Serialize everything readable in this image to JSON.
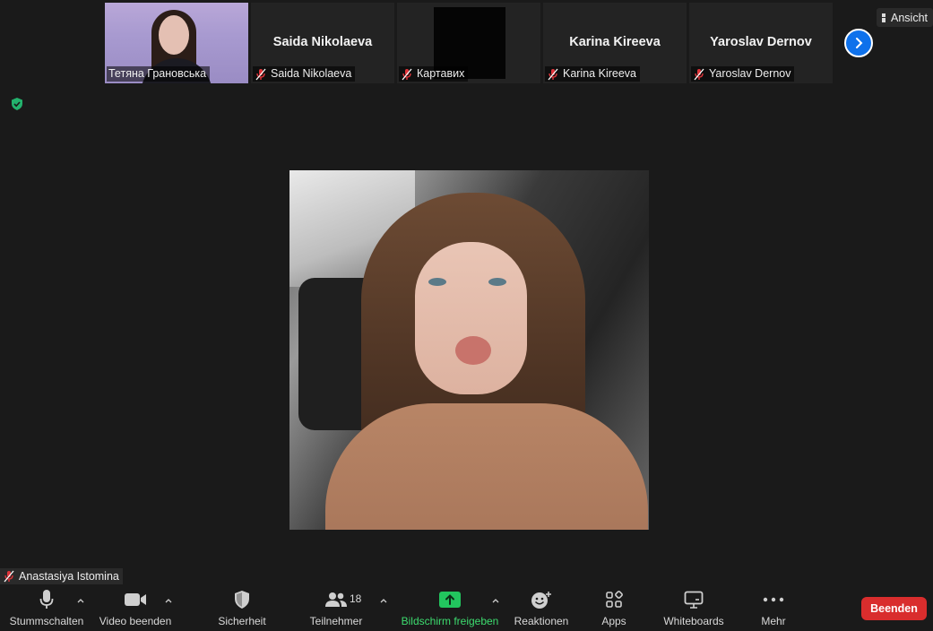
{
  "participants_strip": [
    {
      "name": "Тетяна Грановська",
      "video": true,
      "muted": false
    },
    {
      "name": "Saida Nikolaeva",
      "display_name": "Saida Nikolaeva",
      "muted": true
    },
    {
      "name": "Картавих",
      "muted": true
    },
    {
      "name": "Karina Kireeva",
      "display_name": "Karina Kireeva",
      "muted": true
    },
    {
      "name": "Yaroslav Dernov",
      "display_name": "Yaroslav Dernov",
      "muted": true
    }
  ],
  "view_button": {
    "label": "Ansicht"
  },
  "active_speaker": {
    "name": "Anastasiya Istomina",
    "muted": true
  },
  "toolbar": {
    "mute": "Stummschalten",
    "video": "Video beenden",
    "security": "Sicherheit",
    "participants": "Teilnehmer",
    "participants_count": "18",
    "share": "Bildschirm freigeben",
    "reactions": "Reaktionen",
    "apps": "Apps",
    "whiteboards": "Whiteboards",
    "more": "Mehr",
    "end": "Beenden"
  },
  "colors": {
    "background": "#1a1a1a",
    "accent_blue": "#0e71eb",
    "share_green": "#22c55e",
    "end_red": "#d92d2d",
    "muted_red": "#e0343a"
  }
}
